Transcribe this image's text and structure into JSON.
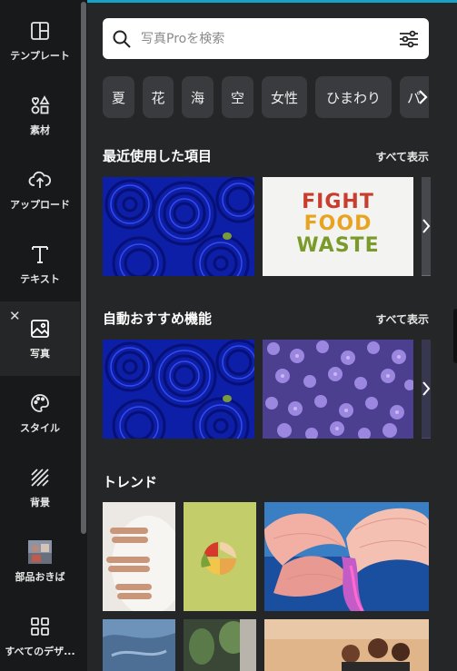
{
  "rail": {
    "items": [
      {
        "label": "テンプレート"
      },
      {
        "label": "素材"
      },
      {
        "label": "アップロード"
      },
      {
        "label": "テキスト"
      },
      {
        "label": "写真"
      },
      {
        "label": "スタイル"
      },
      {
        "label": "背景"
      },
      {
        "label": "部品おきば"
      },
      {
        "label": "すべてのデザ..."
      }
    ],
    "close_glyph": "✕"
  },
  "search": {
    "placeholder": "写真Proを検索"
  },
  "chips": [
    "夏",
    "花",
    "海",
    "空",
    "女性",
    "ひまわり",
    "パ"
  ],
  "sections": {
    "recent": {
      "title": "最近使用した項目",
      "see_all": "すべて表示"
    },
    "auto": {
      "title": "自動おすすめ機能",
      "see_all": "すべて表示"
    },
    "trend": {
      "title": "トレンド"
    }
  },
  "images": {
    "fight_food_waste": {
      "line1": "FIGHT",
      "line2": "FOOD",
      "line3": "WASTE"
    }
  },
  "colors": {
    "accent": "#17a2c6",
    "panel": "#252627",
    "rail": "#18191b"
  }
}
